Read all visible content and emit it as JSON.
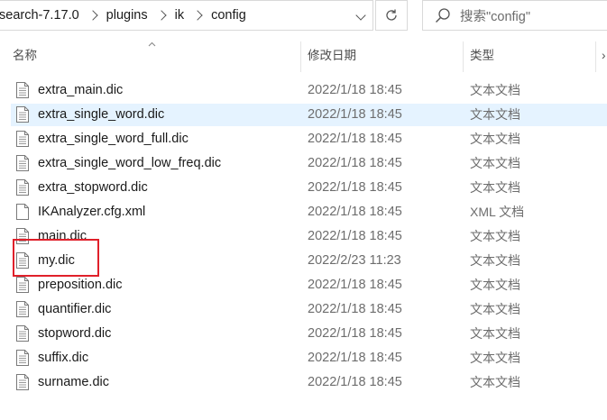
{
  "breadcrumb": {
    "items": [
      "search-7.17.0",
      "plugins",
      "ik",
      "config"
    ]
  },
  "search": {
    "placeholder": "搜索\"config\""
  },
  "columns": {
    "name": "名称",
    "date_modified": "修改日期",
    "type": "类型"
  },
  "files": [
    {
      "name": "extra_main.dic",
      "date": "2022/1/18 18:45",
      "type": "文本文档",
      "selected": false
    },
    {
      "name": "extra_single_word.dic",
      "date": "2022/1/18 18:45",
      "type": "文本文档",
      "selected": true
    },
    {
      "name": "extra_single_word_full.dic",
      "date": "2022/1/18 18:45",
      "type": "文本文档",
      "selected": false
    },
    {
      "name": "extra_single_word_low_freq.dic",
      "date": "2022/1/18 18:45",
      "type": "文本文档",
      "selected": false
    },
    {
      "name": "extra_stopword.dic",
      "date": "2022/1/18 18:45",
      "type": "文本文档",
      "selected": false
    },
    {
      "name": "IKAnalyzer.cfg.xml",
      "date": "2022/1/18 18:45",
      "type": "XML 文档",
      "selected": false
    },
    {
      "name": "main.dic",
      "date": "2022/1/18 18:45",
      "type": "文本文档",
      "selected": false
    },
    {
      "name": "my.dic",
      "date": "2022/2/23 11:23",
      "type": "文本文档",
      "selected": false
    },
    {
      "name": "preposition.dic",
      "date": "2022/1/18 18:45",
      "type": "文本文档",
      "selected": false
    },
    {
      "name": "quantifier.dic",
      "date": "2022/1/18 18:45",
      "type": "文本文档",
      "selected": false
    },
    {
      "name": "stopword.dic",
      "date": "2022/1/18 18:45",
      "type": "文本文档",
      "selected": false
    },
    {
      "name": "suffix.dic",
      "date": "2022/1/18 18:45",
      "type": "文本文档",
      "selected": false
    },
    {
      "name": "surname.dic",
      "date": "2022/1/18 18:45",
      "type": "文本文档",
      "selected": false
    }
  ],
  "colors": {
    "selection": "#e5f3ff",
    "highlight_box": "#e0202a"
  }
}
